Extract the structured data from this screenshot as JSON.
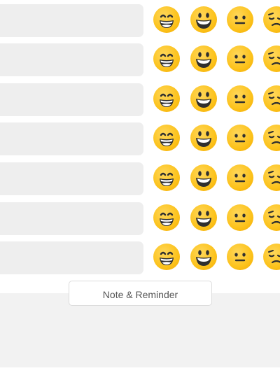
{
  "mood_rows": [
    {
      "value": "",
      "options": [
        "grinning-face-icon",
        "smiling-face-icon",
        "neutral-face-icon",
        "sad-face-icon"
      ]
    },
    {
      "value": "",
      "options": [
        "grinning-face-icon",
        "smiling-face-icon",
        "neutral-face-icon",
        "sad-face-icon"
      ]
    },
    {
      "value": "",
      "options": [
        "grinning-face-icon",
        "smiling-face-icon",
        "neutral-face-icon",
        "sad-face-icon"
      ]
    },
    {
      "value": "",
      "options": [
        "grinning-face-icon",
        "smiling-face-icon",
        "neutral-face-icon",
        "sad-face-icon"
      ]
    },
    {
      "value": "",
      "options": [
        "grinning-face-icon",
        "smiling-face-icon",
        "neutral-face-icon",
        "sad-face-icon"
      ]
    },
    {
      "value": "",
      "options": [
        "grinning-face-icon",
        "smiling-face-icon",
        "neutral-face-icon",
        "sad-face-icon"
      ]
    },
    {
      "value": "",
      "options": [
        "grinning-face-icon",
        "smiling-face-icon",
        "neutral-face-icon",
        "sad-face-icon"
      ]
    }
  ],
  "note_button": {
    "label": "Note & Reminder"
  },
  "colors": {
    "emoji_yellow": "#fcc21b",
    "field_bg": "#eeeeee",
    "footer_bg": "#f2f2f2"
  }
}
